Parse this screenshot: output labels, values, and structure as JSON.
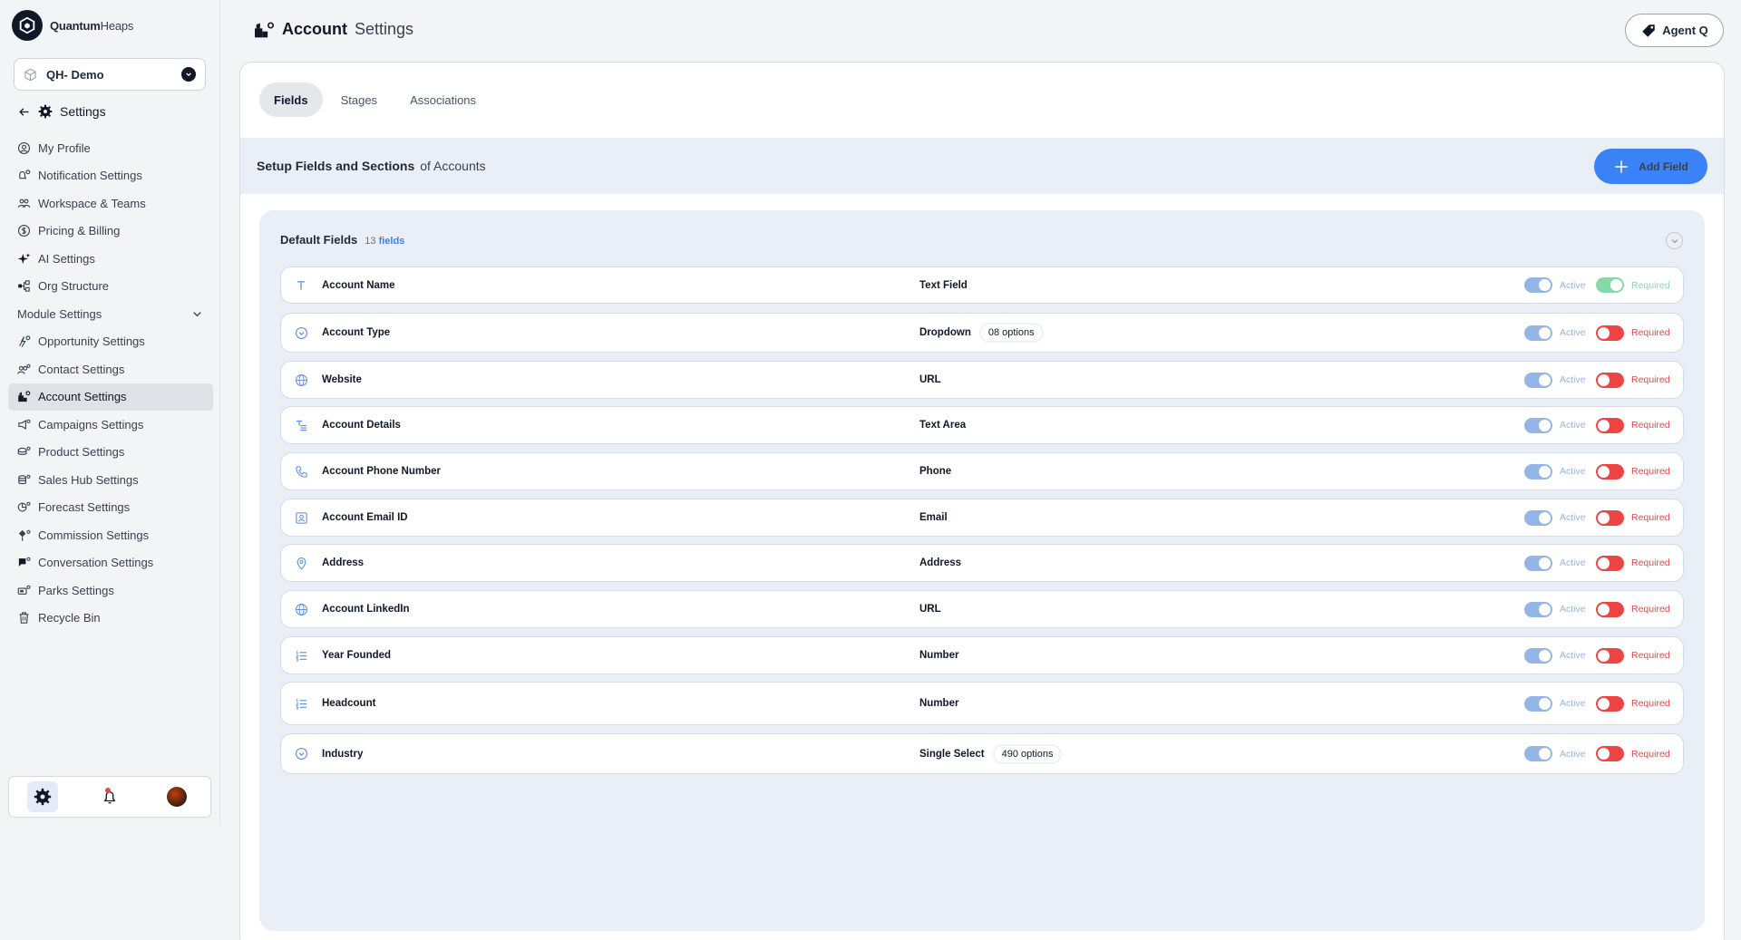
{
  "brand": {
    "name_bold": "Quantum",
    "name_rest": "Heaps"
  },
  "workspace": {
    "label": "QH- Demo"
  },
  "settings_head": {
    "label": "Settings"
  },
  "sidebar": {
    "items": [
      {
        "label": "My Profile",
        "icon": "user-circle-icon"
      },
      {
        "label": "Notification Settings",
        "icon": "bell-settings-icon"
      },
      {
        "label": "Workspace & Teams",
        "icon": "team-icon"
      },
      {
        "label": "Pricing & Billing",
        "icon": "dollar-icon"
      },
      {
        "label": "AI Settings",
        "icon": "sparkle-icon"
      },
      {
        "label": "Org Structure",
        "icon": "org-icon"
      },
      {
        "label": "Module Settings",
        "icon": "chevron-down-icon"
      },
      {
        "label": "Opportunity Settings",
        "icon": "opportunity-icon"
      },
      {
        "label": "Contact Settings",
        "icon": "contact-icon"
      },
      {
        "label": "Account Settings",
        "icon": "account-icon"
      },
      {
        "label": "Campaigns Settings",
        "icon": "campaign-icon"
      },
      {
        "label": "Product Settings",
        "icon": "product-icon"
      },
      {
        "label": "Sales Hub Settings",
        "icon": "sales-hub-icon"
      },
      {
        "label": "Forecast Settings",
        "icon": "forecast-icon"
      },
      {
        "label": "Commission Settings",
        "icon": "commission-icon"
      },
      {
        "label": "Conversation Settings",
        "icon": "conversation-icon"
      },
      {
        "label": "Parks Settings",
        "icon": "parks-icon"
      },
      {
        "label": "Recycle Bin",
        "icon": "trash-icon"
      }
    ]
  },
  "header": {
    "title_bold": "Account",
    "title_rest": "Settings",
    "agent_label": "Agent Q"
  },
  "tabs": [
    {
      "label": "Fields"
    },
    {
      "label": "Stages"
    },
    {
      "label": "Associations"
    }
  ],
  "setup": {
    "title": "Setup Fields and Sections",
    "suffix": "of Accounts",
    "add_label": "Add Field"
  },
  "default_fields": {
    "title": "Default Fields",
    "count_num": "13",
    "count_word": "fields",
    "active_label": "Active",
    "required_label": "Required",
    "rows": [
      {
        "name": "Account Name",
        "type": "Text Field",
        "options": "",
        "icon": "text-t-icon",
        "required": true
      },
      {
        "name": "Account Type",
        "type": "Dropdown",
        "options": "08 options",
        "icon": "dropdown-circle-icon",
        "required": false
      },
      {
        "name": "Website",
        "type": "URL",
        "options": "",
        "icon": "globe-icon",
        "required": false
      },
      {
        "name": "Account Details",
        "type": "Text Area",
        "options": "",
        "icon": "text-area-icon",
        "required": false
      },
      {
        "name": "Account Phone Number",
        "type": "Phone",
        "options": "",
        "icon": "phone-icon",
        "required": false
      },
      {
        "name": "Account Email ID",
        "type": "Email",
        "options": "",
        "icon": "email-contact-icon",
        "required": false
      },
      {
        "name": "Address",
        "type": "Address",
        "options": "",
        "icon": "location-pin-icon",
        "required": false
      },
      {
        "name": "Account LinkedIn",
        "type": "URL",
        "options": "",
        "icon": "globe-icon",
        "required": false
      },
      {
        "name": "Year Founded",
        "type": "Number",
        "options": "",
        "icon": "numbered-list-icon",
        "required": false
      },
      {
        "name": "Headcount",
        "type": "Number",
        "options": "",
        "icon": "numbered-list-icon",
        "required": false
      },
      {
        "name": "Industry",
        "type": "Single Select",
        "options": "490 options",
        "icon": "dropdown-circle-icon",
        "required": false
      }
    ]
  },
  "colors": {
    "accent": "#3b82f6",
    "active_toggle": "#93b5e8",
    "required_on": "#86d9a8",
    "required_off": "#ef4444"
  }
}
